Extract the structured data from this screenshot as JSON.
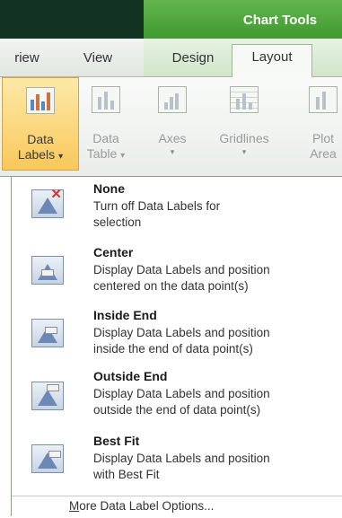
{
  "context_tab_group": "Chart Tools",
  "tabs": [
    {
      "label": "riew",
      "active": false
    },
    {
      "label": "View",
      "active": false
    },
    {
      "label": "Design",
      "active": false
    },
    {
      "label": "Layout",
      "active": true
    }
  ],
  "ribbon_buttons": {
    "data_labels": {
      "line1": "Data",
      "line2": "Labels",
      "caret": "▾",
      "state": "active"
    },
    "data_table": {
      "line1": "Data",
      "line2": "Table",
      "caret": "▾",
      "state": "disabled"
    },
    "axes": {
      "line1": "Axes",
      "caret": "▾",
      "state": "disabled"
    },
    "gridlines": {
      "line1": "Gridlines",
      "caret": "▾",
      "state": "disabled"
    },
    "plot_area": {
      "line1": "Plot",
      "line2": "Area",
      "caret": "▾",
      "state": "disabled"
    }
  },
  "menu": {
    "items": [
      {
        "title": "None",
        "line1": "Turn off Data Labels for",
        "line2": "selection",
        "icon": "no-labels-icon"
      },
      {
        "title": "Center",
        "line1": "Display Data Labels and position",
        "line2": "centered on the data point(s)",
        "icon": "labels-center-icon"
      },
      {
        "title": "Inside End",
        "line1": "Display Data Labels and position",
        "line2": "inside the end of data point(s)",
        "icon": "labels-inside-end-icon"
      },
      {
        "title": "Outside End",
        "line1": "Display Data Labels and position",
        "line2": "outside the end of data point(s)",
        "icon": "labels-outside-end-icon"
      },
      {
        "title": "Best Fit",
        "line1": "Display Data Labels and position",
        "line2": "with Best Fit",
        "icon": "labels-best-fit-icon"
      }
    ],
    "footer": {
      "mnemonic": "M",
      "rest": "ore Data Label Options..."
    }
  },
  "colors": {
    "title_bar": "#123222",
    "chart_tools": "#4fa63d",
    "active_button": "#f8c85a",
    "icon_blue": "#6c88b6",
    "none_mark": "#e0302b"
  }
}
